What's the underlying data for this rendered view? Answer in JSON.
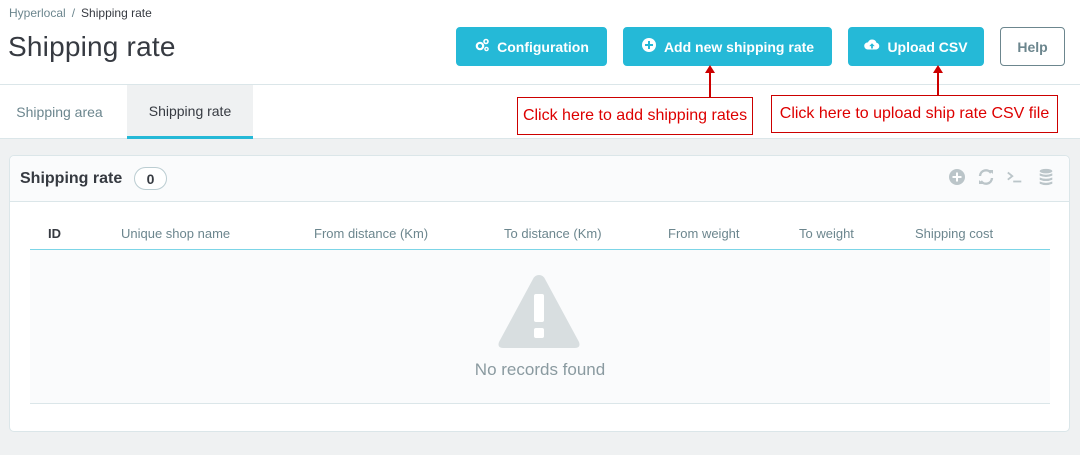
{
  "breadcrumb": {
    "parent": "Hyperlocal",
    "separator": "/",
    "current": "Shipping rate"
  },
  "page_title": "Shipping rate",
  "toolbar": {
    "configuration_label": "Configuration",
    "add_label": "Add new shipping rate",
    "upload_label": "Upload CSV",
    "help_label": "Help"
  },
  "tabs": [
    {
      "label": "Shipping area",
      "active": false
    },
    {
      "label": "Shipping rate",
      "active": true
    }
  ],
  "annotations": {
    "add_note": "Click here to add shipping rates",
    "upload_note": "Click here to upload ship rate CSV file"
  },
  "panel": {
    "title": "Shipping rate",
    "count": "0",
    "columns": [
      "ID",
      "Unique shop name",
      "From distance (Km)",
      "To distance (Km)",
      "From weight",
      "To weight",
      "Shipping cost"
    ],
    "empty_text": "No records found"
  },
  "icons": {
    "configuration": "cogs-icon",
    "add": "plus-circle-icon",
    "upload": "cloud-upload-icon",
    "tools": [
      "add-circle-icon",
      "refresh-icon",
      "terminal-icon",
      "database-icon"
    ],
    "empty": "warning-icon"
  },
  "colors": {
    "primary": "#25b9d7",
    "annotation": "#cc0000",
    "text": "#363a41",
    "muted": "#6c868e"
  }
}
